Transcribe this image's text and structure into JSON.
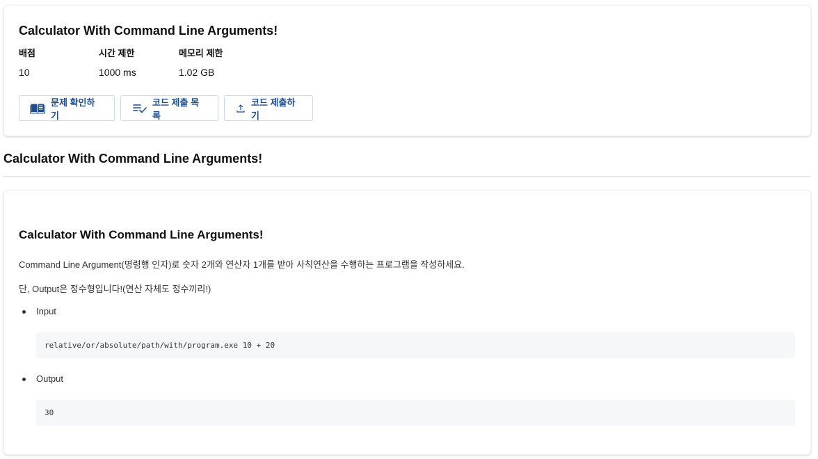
{
  "header": {
    "title": "Calculator With Command Line Arguments!",
    "meta": [
      {
        "label": "배점",
        "value": "10"
      },
      {
        "label": "시간 제한",
        "value": "1000 ms"
      },
      {
        "label": "메모리 제한",
        "value": "1.02 GB"
      }
    ],
    "buttons": {
      "view_problem": "문제 확인하기",
      "submission_list": "코드 제출 목록",
      "submit_code": "코드 제출하기"
    }
  },
  "section_title": "Calculator With Command Line Arguments!",
  "problem": {
    "heading": "Calculator With Command Line Arguments!",
    "paragraph1": "Command Line Argument(명령행 인자)로 숫자 2개와 연산자 1개를 받아 사칙연산을 수행하는 프로그램을 작성하세요.",
    "paragraph2": "단, Output은 정수형입니다!(연산 자체도 정수끼리!)",
    "items": [
      {
        "label": "Input",
        "code": "relative/or/absolute/path/with/program.exe 10 + 20"
      },
      {
        "label": "Output",
        "code": "30"
      }
    ]
  },
  "colors": {
    "accent": "#1e4f8c",
    "button_border": "#c7dbee",
    "code_bg": "#f6f7f8"
  }
}
